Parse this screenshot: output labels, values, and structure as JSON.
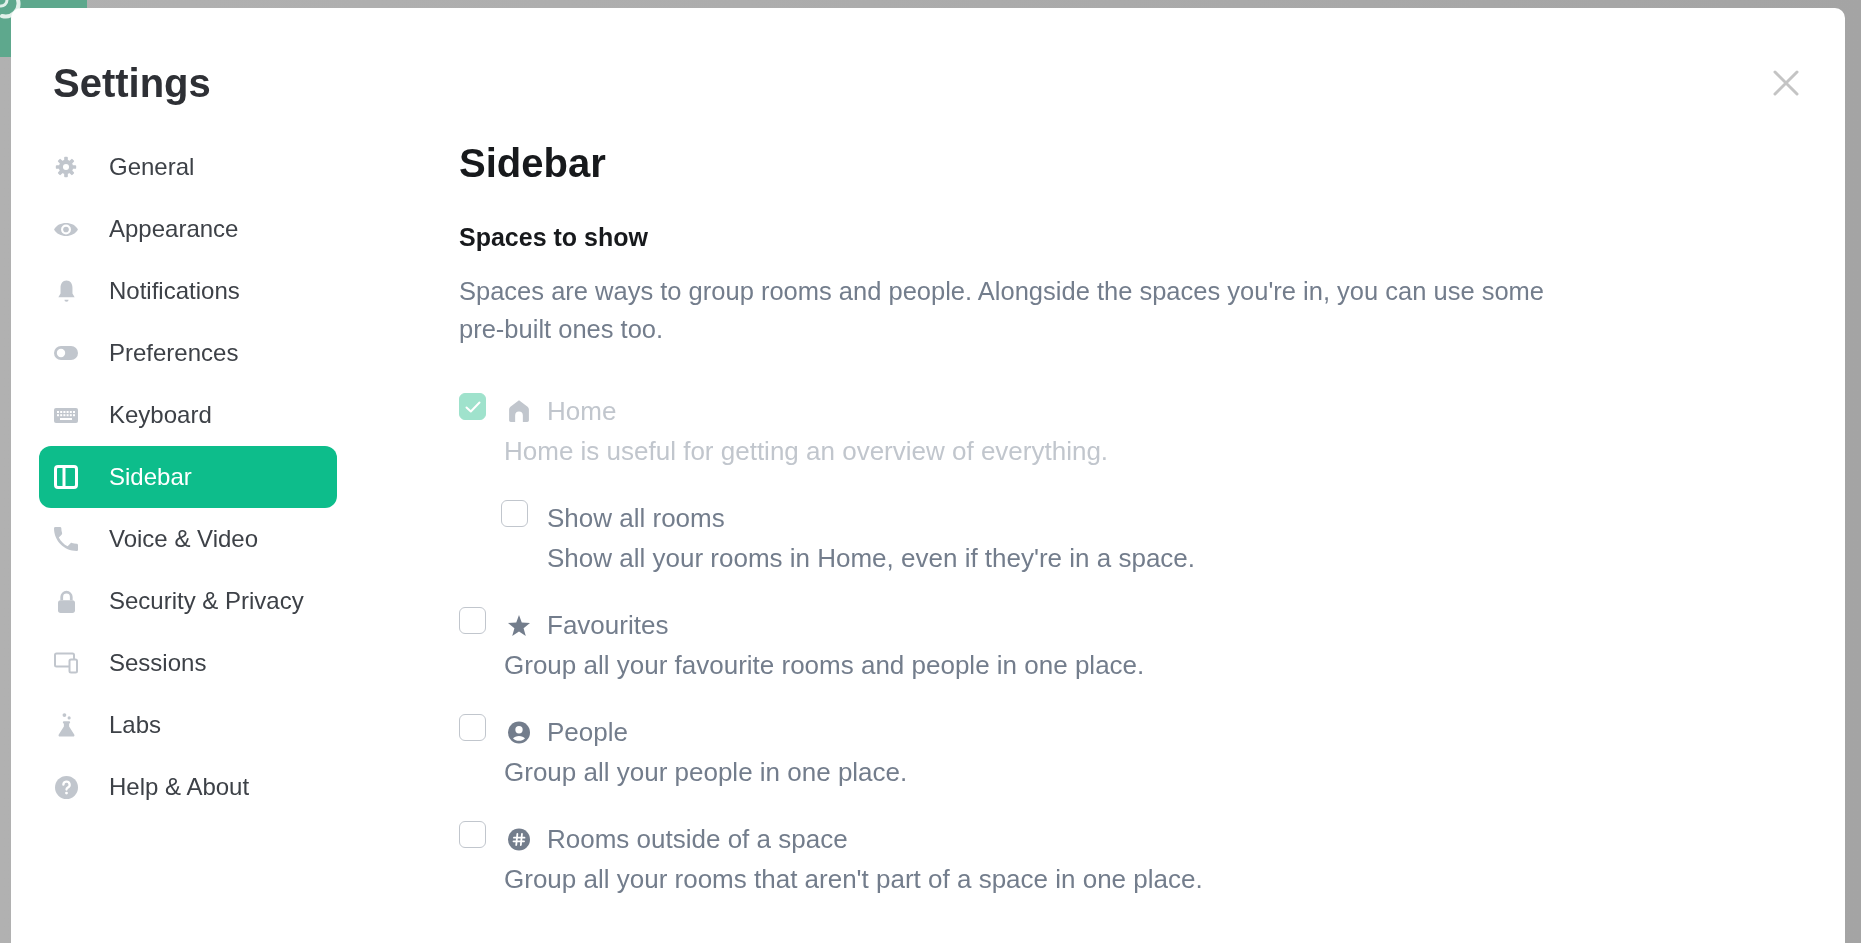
{
  "dialog": {
    "title": "Settings"
  },
  "sidebar": {
    "items": [
      {
        "label": "General",
        "selected": false
      },
      {
        "label": "Appearance",
        "selected": false
      },
      {
        "label": "Notifications",
        "selected": false
      },
      {
        "label": "Preferences",
        "selected": false
      },
      {
        "label": "Keyboard",
        "selected": false
      },
      {
        "label": "Sidebar",
        "selected": true
      },
      {
        "label": "Voice & Video",
        "selected": false
      },
      {
        "label": "Security & Privacy",
        "selected": false
      },
      {
        "label": "Sessions",
        "selected": false
      },
      {
        "label": "Labs",
        "selected": false
      },
      {
        "label": "Help & About",
        "selected": false
      }
    ]
  },
  "content": {
    "heading": "Sidebar",
    "section": {
      "title": "Spaces to show",
      "description": "Spaces are ways to group rooms and people. Alongside the spaces you're in, you can use some pre-built ones too.",
      "options": [
        {
          "label": "Home",
          "description": "Home is useful for getting an overview of everything.",
          "checked": true,
          "disabled": true,
          "children": [
            {
              "label": "Show all rooms",
              "description": "Show all your rooms in Home, even if they're in a space.",
              "checked": false,
              "disabled": false
            }
          ]
        },
        {
          "label": "Favourites",
          "description": "Group all your favourite rooms and people in one place.",
          "checked": false,
          "disabled": false
        },
        {
          "label": "People",
          "description": "Group all your people in one place.",
          "checked": false,
          "disabled": false
        },
        {
          "label": "Rooms outside of a space",
          "description": "Group all your rooms that aren't part of a space in one place.",
          "checked": false,
          "disabled": false
        }
      ]
    }
  }
}
